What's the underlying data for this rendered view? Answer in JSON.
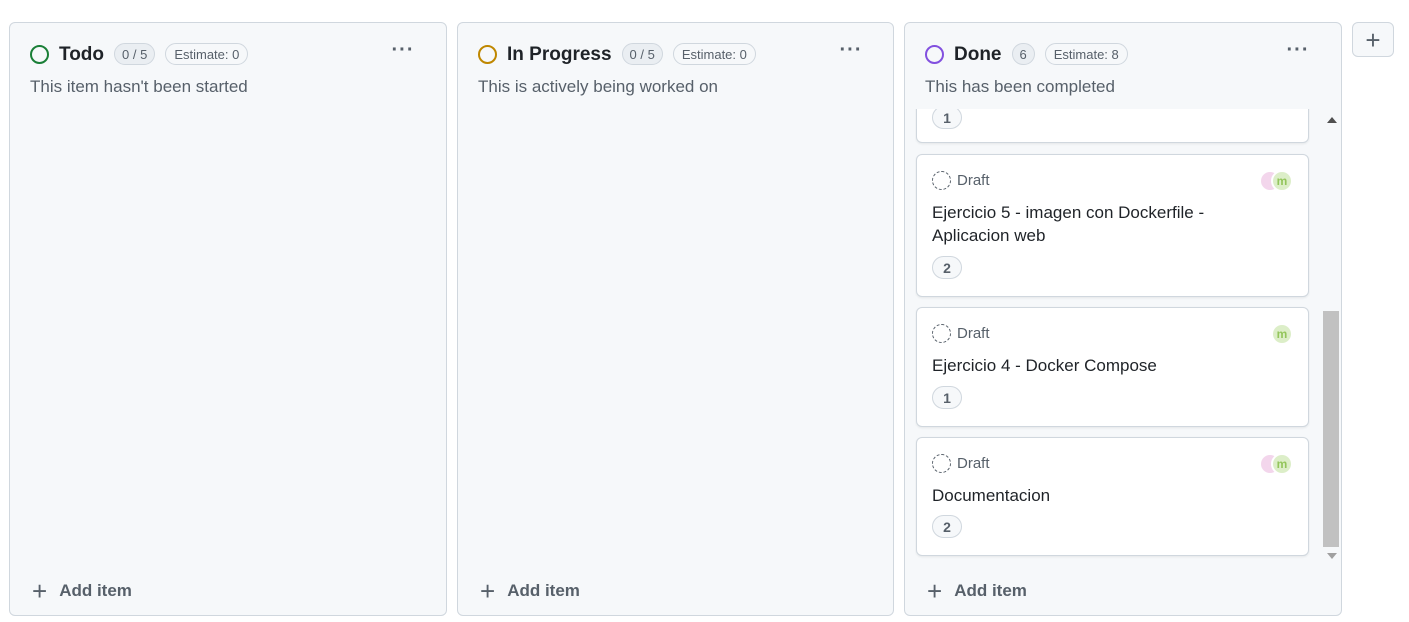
{
  "colors": {
    "todo": "#1a7f37",
    "in_progress": "#bf8700",
    "done": "#8250df"
  },
  "columns": [
    {
      "title": "Todo",
      "count": "0 / 5",
      "estimate": "Estimate: 0",
      "description": "This item hasn't been started",
      "add_label": "Add item"
    },
    {
      "title": "In Progress",
      "count": "0 / 5",
      "estimate": "Estimate: 0",
      "description": "This is actively being worked on",
      "add_label": "Add item"
    },
    {
      "title": "Done",
      "count": "6",
      "estimate": "Estimate: 8",
      "description": "This has been completed",
      "add_label": "Add item",
      "cards": [
        {
          "status": "",
          "title": "",
          "estimate": "1"
        },
        {
          "status": "Draft",
          "title": "Ejercicio 5 - imagen con Dockerfile - Aplicacion web",
          "estimate": "2"
        },
        {
          "status": "Draft",
          "title": "Ejercicio 4 - Docker Compose",
          "estimate": "1"
        },
        {
          "status": "Draft",
          "title": "Documentacion",
          "estimate": "2"
        }
      ]
    }
  ],
  "more_icon": "···",
  "plus_icon": "+",
  "avatar_letter": "m"
}
